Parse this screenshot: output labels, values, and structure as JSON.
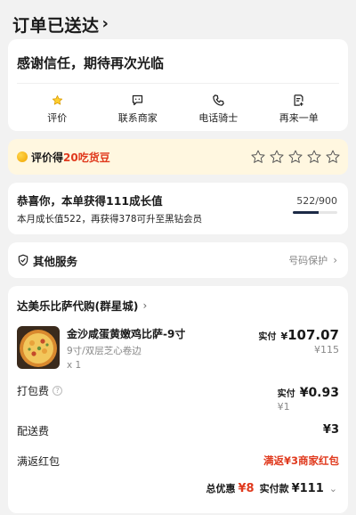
{
  "header": {
    "title": "订单已送达",
    "chevron": "›"
  },
  "thanks": {
    "message": "感谢信任，期待再次光临",
    "actions": [
      {
        "label": "评价",
        "icon": "star-icon"
      },
      {
        "label": "联系商家",
        "icon": "chat-icon"
      },
      {
        "label": "电话骑士",
        "icon": "phone-icon"
      },
      {
        "label": "再来一单",
        "icon": "reorder-icon"
      }
    ]
  },
  "review": {
    "prefix": "评价得",
    "reward": "20吃货豆",
    "star_count": 5,
    "rating": 0
  },
  "growth": {
    "headline": "恭喜你，本单获得111成长值",
    "detail": "本月成长值522，再获得378可升至黑钻会员",
    "progress_text": "522/900",
    "progress_fraction": 0.58
  },
  "services": {
    "title": "其他服务",
    "right_label": "号码保护",
    "chevron": "›"
  },
  "order": {
    "store_name": "达美乐比萨代购(群星城)",
    "store_chevron": "›",
    "item": {
      "name": "金沙咸蛋黄嫩鸡比萨-9寸",
      "spec": "9寸/双层芝心卷边",
      "qty": "x 1",
      "paid_label": "实付",
      "paid_symbol": "¥",
      "paid_value": "107.07",
      "original": "¥115"
    },
    "packing": {
      "label": "打包费",
      "help": "?",
      "paid_label": "实付",
      "paid_value": "¥0.93",
      "original": "¥1"
    },
    "delivery": {
      "label": "配送费",
      "value": "¥3"
    },
    "red_packet": {
      "label": "满返红包",
      "value": "满返¥3商家红包"
    },
    "total": {
      "discount_label": "总优惠",
      "discount_value": "¥8",
      "paid_label": "实付款",
      "paid_value": "¥111",
      "chevron": "⌄"
    }
  },
  "colors": {
    "accent_red": "#e03a1e",
    "gold": "#f0a400",
    "navy": "#1c2a46"
  }
}
